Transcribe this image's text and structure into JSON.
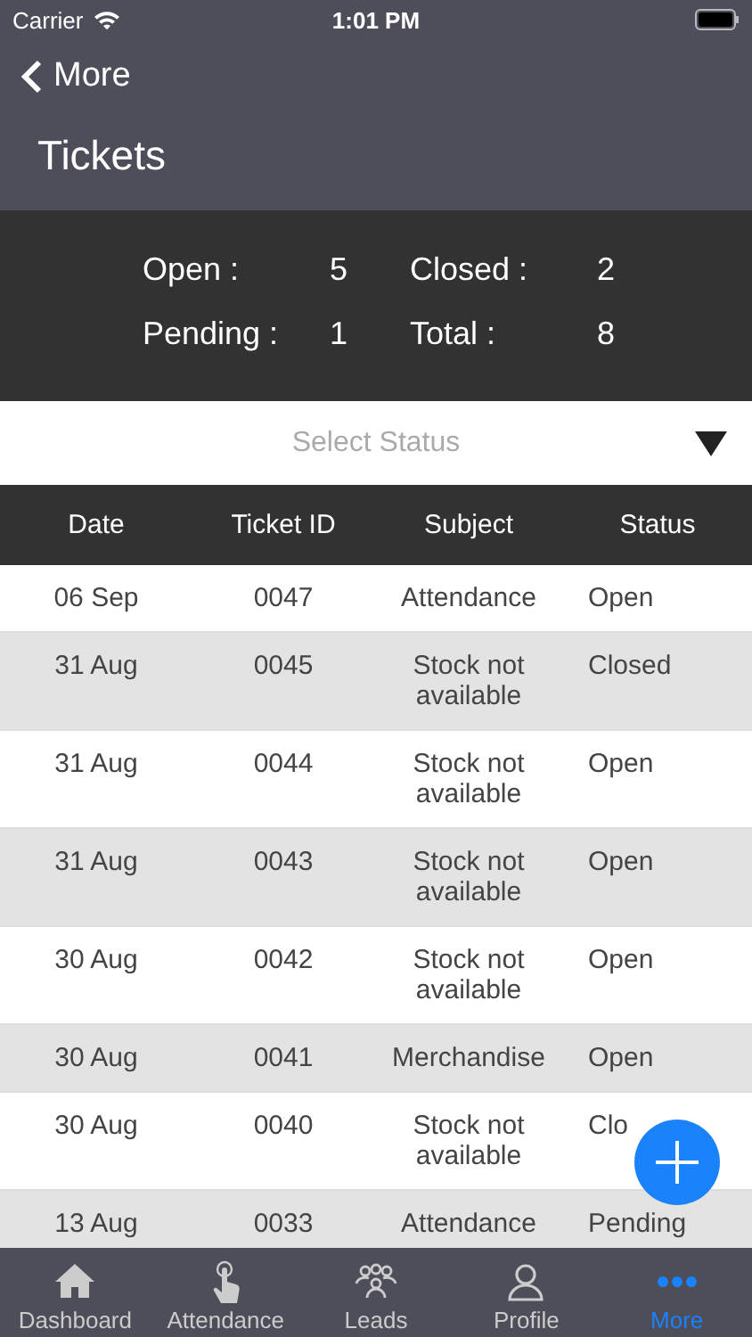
{
  "status_bar": {
    "carrier": "Carrier",
    "time": "1:01 PM"
  },
  "nav": {
    "back": "More",
    "title": "Tickets"
  },
  "summary": [
    {
      "label": "Open :",
      "value": "5"
    },
    {
      "label": "Closed :",
      "value": "2"
    },
    {
      "label": "Pending :",
      "value": "1"
    },
    {
      "label": "Total :",
      "value": "8"
    }
  ],
  "status_select": {
    "placeholder": "Select Status"
  },
  "table": {
    "columns": [
      "Date",
      "Ticket ID",
      "Subject",
      "Status"
    ],
    "rows": [
      [
        "06 Sep",
        "0047",
        "Attendance",
        "Open"
      ],
      [
        "31 Aug",
        "0045",
        "Stock not available",
        "Closed"
      ],
      [
        "31 Aug",
        "0044",
        "Stock not available",
        "Open"
      ],
      [
        "31 Aug",
        "0043",
        "Stock not available",
        "Open"
      ],
      [
        "30 Aug",
        "0042",
        "Stock not available",
        "Open"
      ],
      [
        "30 Aug",
        "0041",
        "Merchandise",
        "Open"
      ],
      [
        "30 Aug",
        "0040",
        "Stock not available",
        "Clo"
      ],
      [
        "13 Aug",
        "0033",
        "Attendance",
        "Pending"
      ]
    ]
  },
  "tab_bar": [
    {
      "label": "Dashboard",
      "kind": "home",
      "selected": false
    },
    {
      "label": "Attendance",
      "kind": "tap",
      "selected": false
    },
    {
      "label": "Leads",
      "kind": "group",
      "selected": false
    },
    {
      "label": "Profile",
      "kind": "person",
      "selected": false
    },
    {
      "label": "More",
      "kind": "dots",
      "selected": true
    }
  ]
}
